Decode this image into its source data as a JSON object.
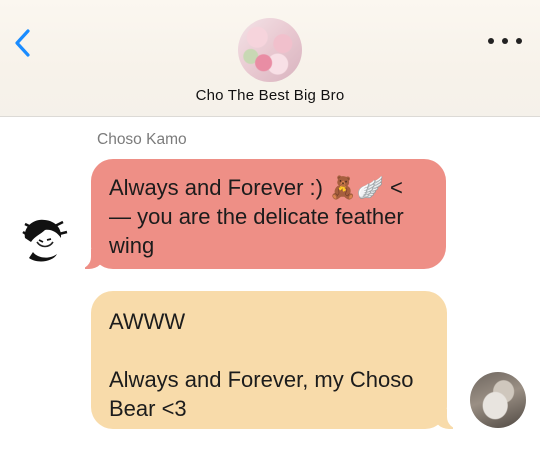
{
  "header": {
    "back_icon": "chevron-left-icon",
    "more_icon": "ellipsis-icon",
    "chat_title": "Cho The Best Big Bro",
    "accent_color": "#1a8cff"
  },
  "messages": [
    {
      "sender": "Choso Kamo",
      "text": "Always and Forever :) 🧸🪽 <\n— you are the delicate feather\nwing",
      "direction": "incoming",
      "color": "#ee8f86"
    },
    {
      "sender": "",
      "text": "AWWW\n\nAlways and Forever, my Choso\nBear <3",
      "direction": "outgoing",
      "color": "#f8dbaa"
    }
  ]
}
